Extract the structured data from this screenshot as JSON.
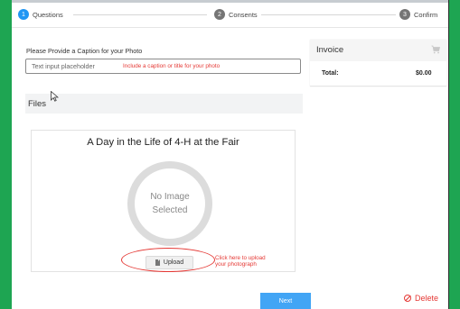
{
  "steps": [
    {
      "number": "1",
      "label": "Questions"
    },
    {
      "number": "2",
      "label": "Consents"
    },
    {
      "number": "3",
      "label": "Confirm"
    }
  ],
  "caption": {
    "label": "Please Provide a Caption for your Photo",
    "placeholder": "Text input placeholder",
    "annotation": "Include a caption or title for your photo"
  },
  "files": {
    "title": "Files"
  },
  "photo": {
    "title": "A Day in the Life of 4-H at the Fair",
    "placeholder_line1": "No Image",
    "placeholder_line2": "Selected",
    "upload_label": "Upload",
    "upload_annotation_line1": "Click here to upload",
    "upload_annotation_line2": "your photograph"
  },
  "actions": {
    "next_label": "Next",
    "delete_label": "Delete"
  },
  "invoice": {
    "title": "Invoice",
    "total_label": "Total:",
    "total_value": "$0.00"
  },
  "colors": {
    "background": "#1ea552",
    "accent": "#2196f3",
    "annotation": "#e53935",
    "next_button": "#42a5f5"
  },
  "icons": [
    "step-number-icon",
    "cursor-icon",
    "file-icon",
    "delete-icon",
    "cart-icon"
  ]
}
